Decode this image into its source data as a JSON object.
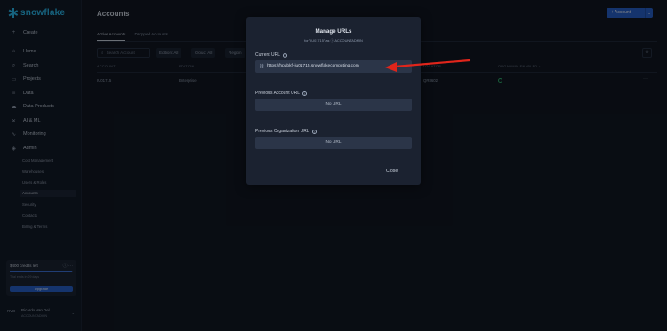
{
  "app": {
    "logo_text": "snowflake"
  },
  "sidebar": {
    "create_label": "Create",
    "items": [
      {
        "label": "Home",
        "icon": "home-icon",
        "glyph": "⌂"
      },
      {
        "label": "Search",
        "icon": "search-icon",
        "glyph": "⌕"
      },
      {
        "label": "Projects",
        "icon": "projects-icon",
        "glyph": "▭"
      },
      {
        "label": "Data",
        "icon": "database-icon",
        "glyph": "≡"
      },
      {
        "label": "Data Products",
        "icon": "cloud-icon",
        "glyph": "☁"
      },
      {
        "label": "AI & ML",
        "icon": "ai-icon",
        "glyph": "✕"
      },
      {
        "label": "Monitoring",
        "icon": "monitoring-icon",
        "glyph": "∿"
      },
      {
        "label": "Admin",
        "icon": "shield-icon",
        "glyph": "◈"
      }
    ],
    "admin_sub_items": [
      "Cost Management",
      "Warehouses",
      "Users & Roles",
      "Accounts",
      "Security",
      "Contacts",
      "Billing & Terms"
    ],
    "active_sub_item": "Accounts",
    "credits": {
      "title": "$400 credits left",
      "subtitle": "Trial ends in 29 days",
      "upgrade_label": "Upgrade",
      "fill_fraction": 0.98
    },
    "user": {
      "initials": "RVD",
      "name": "Ricardo Van Del...",
      "role": "ACCOUNTADMIN"
    }
  },
  "main": {
    "title": "Accounts",
    "add_button_label": "+ Account",
    "tabs": [
      "Active Accounts",
      "Dropped Accounts"
    ],
    "search_placeholder": "Search Account",
    "filters": [
      "Edition: All",
      "Cloud: All",
      "Region"
    ],
    "columns": [
      "ACCOUNT",
      "EDITION",
      "LOCATOR",
      "ORGADMIN ENABLED ↑"
    ],
    "rows": [
      {
        "account": "IU01715",
        "edition": "Enterprise",
        "locator": "QR8602"
      }
    ]
  },
  "modal": {
    "title": "Manage URLs",
    "subtitle_prefix": "for \"IU01715\" as",
    "subtitle_role": "ACCOUNTADMIN",
    "current_url_label": "Current URL",
    "current_url_value": "https://hpubkfl-iu01715.snowflakecomputing.com",
    "previous_account_label": "Previous Account URL",
    "previous_account_value": "No URL",
    "previous_org_label": "Previous Organization URL",
    "previous_org_value": "No URL",
    "close_label": "Close"
  },
  "colors": {
    "accent": "#29b5e8",
    "primary_button": "#2760c7",
    "annotation_arrow": "#e0251b",
    "status_ok": "#2fa96a"
  }
}
